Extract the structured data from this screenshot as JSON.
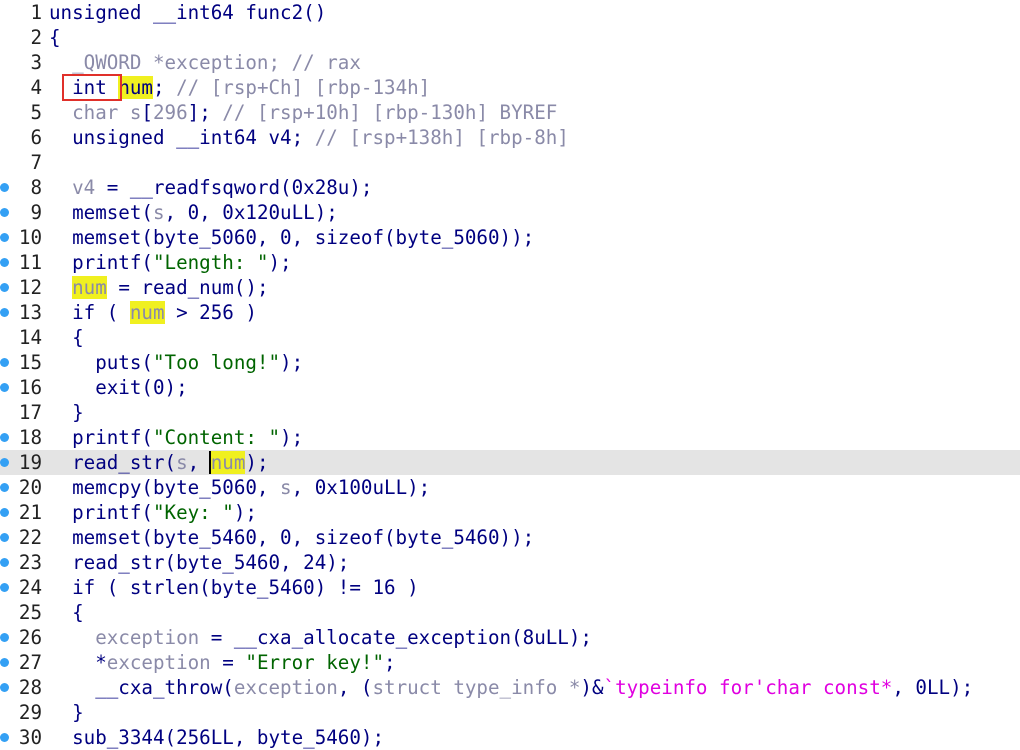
{
  "colors": {
    "keyword_text": "#000080",
    "variable": "#8a8aa8",
    "comment": "#8a8aa8",
    "string": "#006400",
    "typeinfo": "#e000e0",
    "highlight": "#f0f020",
    "current_line": "#e4e4e4",
    "breakpoint_dot": "#34a0f4",
    "annotation_box": "#e0302a"
  },
  "lines": [
    {
      "n": "1",
      "dot": false,
      "tokens": [
        [
          "t",
          "unsigned __int64 func2()"
        ]
      ]
    },
    {
      "n": "2",
      "dot": false,
      "tokens": [
        [
          "t",
          "{"
        ]
      ]
    },
    {
      "n": "3",
      "dot": false,
      "tokens": [
        [
          "v",
          "  _QWORD *exception; // rax"
        ]
      ]
    },
    {
      "n": "4",
      "dot": false,
      "tokens": [
        [
          "t",
          "  int "
        ],
        [
          "h",
          "num"
        ],
        [
          "t",
          "; "
        ],
        [
          "c",
          "// [rsp+Ch] [rbp-134h]"
        ]
      ]
    },
    {
      "n": "5",
      "dot": false,
      "tokens": [
        [
          "v",
          "  char s"
        ],
        [
          "t",
          "["
        ],
        [
          "v",
          "296"
        ],
        [
          "t",
          "]; "
        ],
        [
          "c",
          "// [rsp+10h] [rbp-130h] BYREF"
        ]
      ]
    },
    {
      "n": "6",
      "dot": false,
      "tokens": [
        [
          "t",
          "  unsigned __int64 v4; "
        ],
        [
          "c",
          "// [rsp+138h] [rbp-8h]"
        ]
      ]
    },
    {
      "n": "7",
      "dot": false,
      "tokens": [
        [
          "t",
          ""
        ]
      ]
    },
    {
      "n": "8",
      "dot": true,
      "tokens": [
        [
          "v",
          "  v4"
        ],
        [
          "t",
          " = __readfsqword(0x28u);"
        ]
      ]
    },
    {
      "n": "9",
      "dot": true,
      "tokens": [
        [
          "t",
          "  memset("
        ],
        [
          "v",
          "s"
        ],
        [
          "t",
          ", 0, 0x120uLL);"
        ]
      ]
    },
    {
      "n": "10",
      "dot": true,
      "tokens": [
        [
          "t",
          "  memset(byte_5060, 0, sizeof(byte_5060));"
        ]
      ]
    },
    {
      "n": "11",
      "dot": true,
      "tokens": [
        [
          "t",
          "  printf("
        ],
        [
          "s",
          "\"Length: \""
        ],
        [
          "t",
          ");"
        ]
      ]
    },
    {
      "n": "12",
      "dot": true,
      "tokens": [
        [
          "t",
          "  "
        ],
        [
          "hv",
          "num"
        ],
        [
          "t",
          " = read_num();"
        ]
      ]
    },
    {
      "n": "13",
      "dot": true,
      "tokens": [
        [
          "t",
          "  if ( "
        ],
        [
          "hv",
          "num"
        ],
        [
          "t",
          " > 256 )"
        ]
      ]
    },
    {
      "n": "14",
      "dot": false,
      "tokens": [
        [
          "t",
          "  {"
        ]
      ]
    },
    {
      "n": "15",
      "dot": true,
      "tokens": [
        [
          "t",
          "    puts("
        ],
        [
          "s",
          "\"Too long!\""
        ],
        [
          "t",
          ");"
        ]
      ]
    },
    {
      "n": "16",
      "dot": true,
      "tokens": [
        [
          "t",
          "    exit(0);"
        ]
      ]
    },
    {
      "n": "17",
      "dot": false,
      "tokens": [
        [
          "t",
          "  }"
        ]
      ]
    },
    {
      "n": "18",
      "dot": true,
      "tokens": [
        [
          "t",
          "  printf("
        ],
        [
          "s",
          "\"Content: \""
        ],
        [
          "t",
          ");"
        ]
      ]
    },
    {
      "n": "19",
      "dot": true,
      "current": true,
      "tokens": [
        [
          "t",
          "  read_str("
        ],
        [
          "v",
          "s"
        ],
        [
          "t",
          ", "
        ],
        [
          "hvc",
          "num"
        ],
        [
          "t",
          ");"
        ]
      ]
    },
    {
      "n": "20",
      "dot": true,
      "tokens": [
        [
          "t",
          "  memcpy(byte_5060, "
        ],
        [
          "v",
          "s"
        ],
        [
          "t",
          ", 0x100uLL);"
        ]
      ]
    },
    {
      "n": "21",
      "dot": true,
      "tokens": [
        [
          "t",
          "  printf("
        ],
        [
          "s",
          "\"Key: \""
        ],
        [
          "t",
          ");"
        ]
      ]
    },
    {
      "n": "22",
      "dot": true,
      "tokens": [
        [
          "t",
          "  memset(byte_5460, 0, sizeof(byte_5460));"
        ]
      ]
    },
    {
      "n": "23",
      "dot": true,
      "tokens": [
        [
          "t",
          "  read_str(byte_5460, 24);"
        ]
      ]
    },
    {
      "n": "24",
      "dot": true,
      "tokens": [
        [
          "t",
          "  if ( strlen(byte_5460) != 16 )"
        ]
      ]
    },
    {
      "n": "25",
      "dot": false,
      "tokens": [
        [
          "t",
          "  {"
        ]
      ]
    },
    {
      "n": "26",
      "dot": true,
      "tokens": [
        [
          "t",
          "    "
        ],
        [
          "v",
          "exception"
        ],
        [
          "t",
          " = __cxa_allocate_exception(8uLL);"
        ]
      ]
    },
    {
      "n": "27",
      "dot": true,
      "tokens": [
        [
          "t",
          "    *"
        ],
        [
          "v",
          "exception"
        ],
        [
          "t",
          " = "
        ],
        [
          "s",
          "\"Error key!\""
        ],
        [
          "t",
          ";"
        ]
      ]
    },
    {
      "n": "28",
      "dot": true,
      "tokens": [
        [
          "t",
          "    __cxa_throw("
        ],
        [
          "v",
          "exception"
        ],
        [
          "t",
          ", ("
        ],
        [
          "v",
          "struct type_info *"
        ],
        [
          "t",
          ")&"
        ],
        [
          "m",
          "`typeinfo for'char const*"
        ],
        [
          "t",
          ", 0LL);"
        ]
      ]
    },
    {
      "n": "29",
      "dot": false,
      "tokens": [
        [
          "t",
          "  }"
        ]
      ]
    },
    {
      "n": "30",
      "dot": true,
      "tokens": [
        [
          "t",
          "  sub_3344(256LL, byte_5460);"
        ]
      ]
    }
  ]
}
